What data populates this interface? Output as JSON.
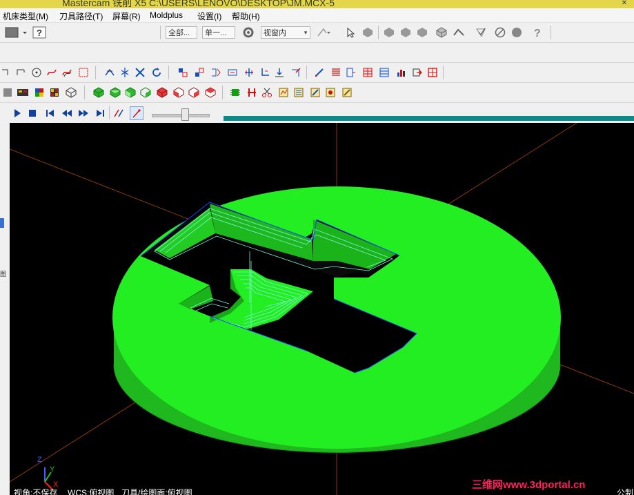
{
  "title": "Mastercam 铣削 X5  C:\\USERS\\LENOVO\\DESKTOP\\JM.MCX-5",
  "menu": [
    "机床类型(M)",
    "刀具路径(T)",
    "屏幕(R)",
    "Moldplus",
    "设置(I)",
    "帮助(H)"
  ],
  "toolbar": {
    "combo_all": "全部...",
    "combo_single": "单一...",
    "combo_view": "视窗内"
  },
  "viewport": {
    "part_color": "#1ee81e",
    "background": "#000000",
    "axis_labels": {
      "z": "Z",
      "y": "Y",
      "x": "X"
    }
  },
  "status": {
    "view": "视角:不保存",
    "wcs": "WCS:俯视图",
    "tplane": "刀具/绘图面:俯视图",
    "right": "公制"
  },
  "watermark": "三维网www.3dportal.cn",
  "left_strip": {
    "mark": "图"
  }
}
